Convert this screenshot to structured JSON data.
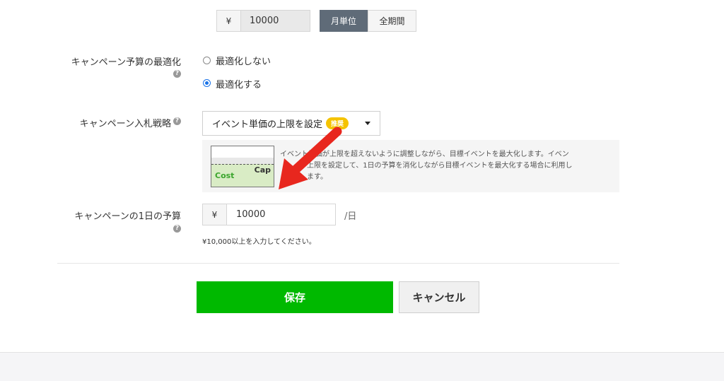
{
  "top_budget": {
    "currency": "¥",
    "value": "10000",
    "unit_monthly": "月単位",
    "unit_total": "全期間"
  },
  "optimization": {
    "label": "キャンペーン予算の最適化",
    "help": "?",
    "options": [
      {
        "label": "最適化しない",
        "selected": false
      },
      {
        "label": "最適化する",
        "selected": true
      }
    ]
  },
  "bid_strategy": {
    "label": "キャンペーン入札戦略",
    "help": "?",
    "selected": "イベント単価の上限を設定",
    "badge": "推奨",
    "diagram": {
      "cap": "Cap",
      "cost": "Cost"
    },
    "description_line1": "イベント単価が上限を超えないように調整しながら、目標イベントを最大化します。イベン",
    "description_line2": "上限を設定して、1日の予算を消化しながら目標イベントを最大化する場合に利用し",
    "description_line3": "ます。"
  },
  "daily_budget": {
    "label": "キャンペーンの1日の予算",
    "help": "?",
    "currency": "¥",
    "value": "10000",
    "unit": "/日",
    "hint": "¥10,000以上を入力してください。"
  },
  "actions": {
    "save": "保存",
    "cancel": "キャンセル"
  },
  "colors": {
    "primary": "#00b900",
    "annotation_arrow": "#e8271e",
    "badge": "#f5c300"
  }
}
